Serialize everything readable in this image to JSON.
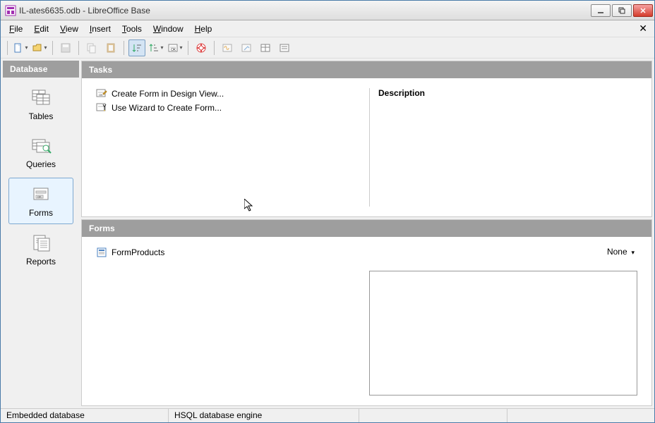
{
  "window": {
    "title": "IL-ates6635.odb - LibreOffice Base"
  },
  "menu": {
    "file": "File",
    "edit": "Edit",
    "view": "View",
    "insert": "Insert",
    "tools": "Tools",
    "window": "Window",
    "help": "Help"
  },
  "sidebar": {
    "header": "Database",
    "items": [
      {
        "label": "Tables"
      },
      {
        "label": "Queries"
      },
      {
        "label": "Forms"
      },
      {
        "label": "Reports"
      }
    ]
  },
  "tasks": {
    "header": "Tasks",
    "items": [
      {
        "label": "Create Form in Design View..."
      },
      {
        "label": "Use Wizard to Create Form..."
      }
    ],
    "description_heading": "Description"
  },
  "forms": {
    "header": "Forms",
    "items": [
      {
        "label": "FormProducts"
      }
    ],
    "preview_mode": "None"
  },
  "statusbar": {
    "db_type": "Embedded database",
    "engine": "HSQL database engine"
  }
}
